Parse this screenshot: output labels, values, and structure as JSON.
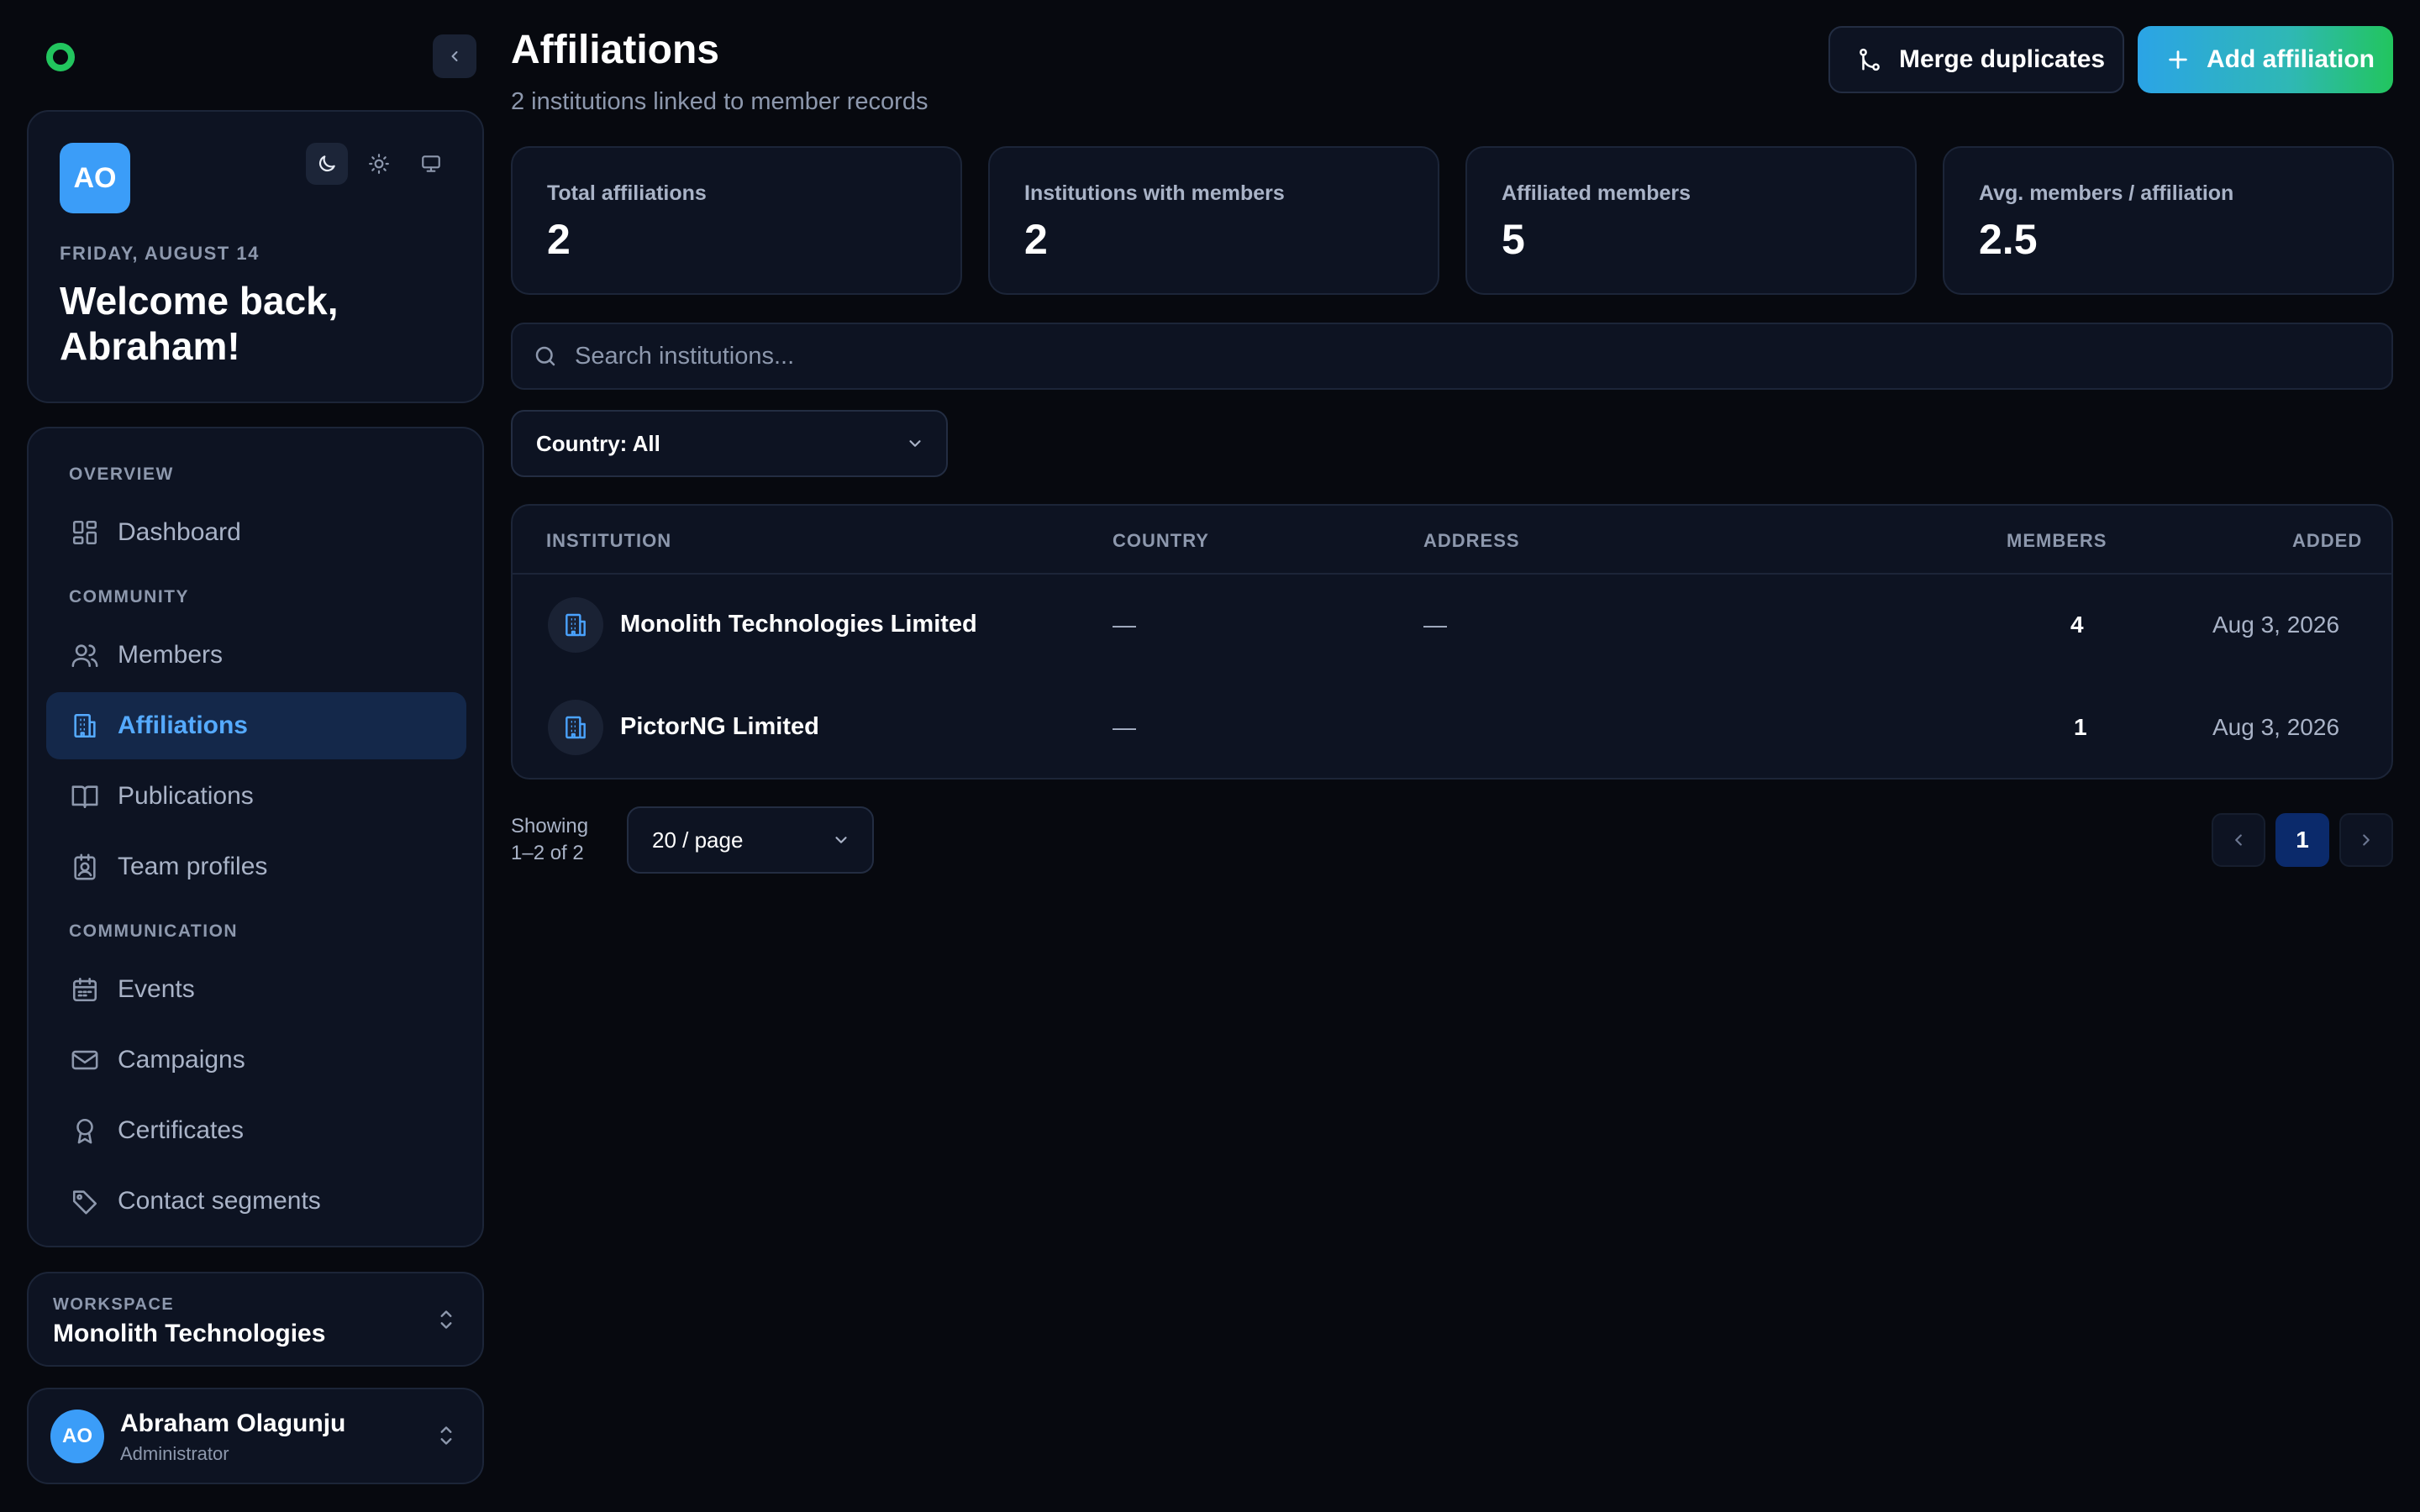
{
  "sidebar": {
    "welcome": {
      "avatar_initials": "AO",
      "date": "FRIDAY, AUGUST 14",
      "greeting": "Welcome back, Abraham!"
    },
    "theme_options": [
      "moon-icon",
      "sun-icon",
      "monitor-icon"
    ],
    "nav": {
      "sections": {
        "overview": "OVERVIEW",
        "community": "COMMUNITY",
        "communication": "COMMUNICATION"
      },
      "items": [
        {
          "label": "Dashboard",
          "icon": "dashboard-icon"
        },
        {
          "label": "Members",
          "icon": "users-icon"
        },
        {
          "label": "Affiliations",
          "icon": "building-icon",
          "active": true
        },
        {
          "label": "Publications",
          "icon": "book-icon"
        },
        {
          "label": "Team profiles",
          "icon": "id-badge-icon"
        },
        {
          "label": "Events",
          "icon": "calendar-icon"
        },
        {
          "label": "Campaigns",
          "icon": "mail-icon"
        },
        {
          "label": "Certificates",
          "icon": "award-icon"
        },
        {
          "label": "Contact segments",
          "icon": "tag-icon"
        }
      ]
    },
    "workspace": {
      "label": "WORKSPACE",
      "name": "Monolith Technologies"
    },
    "user": {
      "initials": "AO",
      "name": "Abraham Olagunju",
      "role": "Administrator"
    }
  },
  "header": {
    "title": "Affiliations",
    "subtitle": "2 institutions linked to member records",
    "merge_label": "Merge duplicates",
    "add_label": "Add affiliation"
  },
  "stats": [
    {
      "label": "Total affiliations",
      "value": "2"
    },
    {
      "label": "Institutions with members",
      "value": "2"
    },
    {
      "label": "Affiliated members",
      "value": "5"
    },
    {
      "label": "Avg. members / affiliation",
      "value": "2.5"
    }
  ],
  "search": {
    "placeholder": "Search institutions..."
  },
  "filters": {
    "country": "Country: All"
  },
  "table": {
    "columns": {
      "institution": "INSTITUTION",
      "country": "COUNTRY",
      "address": "ADDRESS",
      "members": "MEMBERS",
      "added": "ADDED"
    },
    "rows": [
      {
        "institution": "Monolith Technologies Limited",
        "country": "—",
        "address": "—",
        "members": "4",
        "added": "Aug 3, 2026"
      },
      {
        "institution": "PictorNG Limited",
        "country": "—",
        "address": "",
        "members": "1",
        "added": "Aug 3, 2026"
      }
    ]
  },
  "pagination": {
    "showing_label": "Showing",
    "showing_range": "1–2 of 2",
    "per_page": "20 / page",
    "current_page": "1"
  },
  "colors": {
    "background": "#07090f",
    "card": "#0d1322",
    "accent": "#55aaff",
    "brand_green": "#22c55e"
  }
}
